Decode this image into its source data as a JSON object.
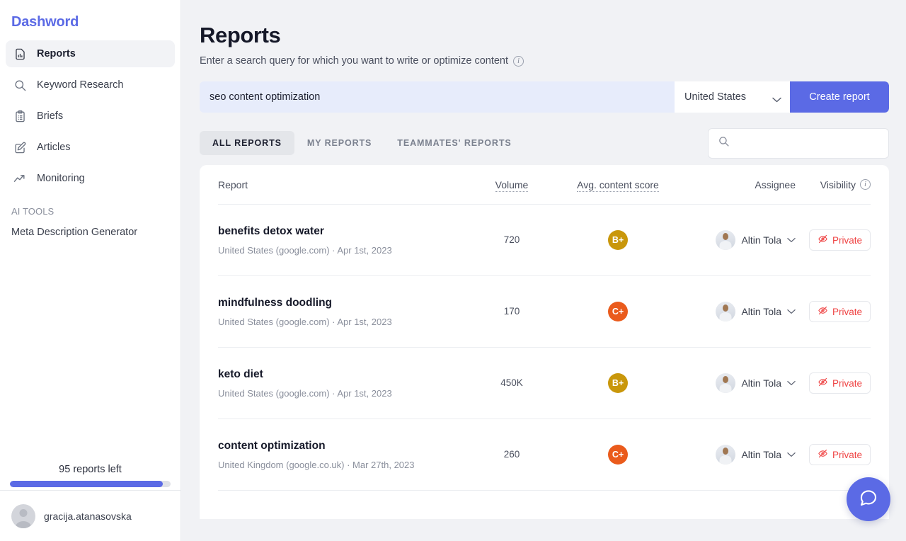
{
  "sidebar": {
    "brand": "Dashword",
    "items": [
      {
        "label": "Reports",
        "icon": "report-doc-icon",
        "active": true
      },
      {
        "label": "Keyword Research",
        "icon": "search-icon",
        "active": false
      },
      {
        "label": "Briefs",
        "icon": "clipboard-icon",
        "active": false
      },
      {
        "label": "Articles",
        "icon": "pencil-square-icon",
        "active": false
      },
      {
        "label": "Monitoring",
        "icon": "trending-up-icon",
        "active": false
      }
    ],
    "section_label": "AI TOOLS",
    "tools": [
      {
        "label": "Meta Description Generator"
      }
    ],
    "quota": {
      "label": "95 reports left",
      "percent": 95
    },
    "user": {
      "name": "gracija.atanasovska",
      "avatar_icon": "user-avatar-icon"
    }
  },
  "header": {
    "title": "Reports",
    "subtitle": "Enter a search query for which you want to write or optimize content",
    "info_icon": "info-icon"
  },
  "query": {
    "value": "seo content optimization",
    "placeholder": "Enter a search query",
    "country": "United States",
    "country_chevron_icon": "chevron-down-icon",
    "create_label": "Create report"
  },
  "tabs": [
    {
      "label": "ALL REPORTS",
      "active": true
    },
    {
      "label": "MY REPORTS",
      "active": false
    },
    {
      "label": "TEAMMATES' REPORTS",
      "active": false
    }
  ],
  "search": {
    "value": "",
    "placeholder": "",
    "icon": "search-icon"
  },
  "table": {
    "columns": {
      "report": "Report",
      "volume": "Volume",
      "score": "Avg. content score",
      "assignee": "Assignee",
      "visibility": "Visibility",
      "visibility_info_icon": "info-icon"
    },
    "rows": [
      {
        "keyword": "benefits detox water",
        "meta": "United States (google.com) · Apr 1st, 2023",
        "volume": "720",
        "score": "B+",
        "score_color": "#c9970b",
        "assignee": "Altin Tola",
        "visibility": "Private",
        "visibility_icon": "eye-off-icon"
      },
      {
        "keyword": "mindfulness doodling",
        "meta": "United States (google.com) · Apr 1st, 2023",
        "volume": "170",
        "score": "C+",
        "score_color": "#ea5b1c",
        "assignee": "Altin Tola",
        "visibility": "Private",
        "visibility_icon": "eye-off-icon"
      },
      {
        "keyword": "keto diet",
        "meta": "United States (google.com) · Apr 1st, 2023",
        "volume": "450K",
        "score": "B+",
        "score_color": "#c9970b",
        "assignee": "Altin Tola",
        "visibility": "Private",
        "visibility_icon": "eye-off-icon"
      },
      {
        "keyword": "content optimization",
        "meta": "United Kingdom (google.co.uk) · Mar 27th, 2023",
        "volume": "260",
        "score": "C+",
        "score_color": "#ea5b1c",
        "assignee": "Altin Tola",
        "visibility": "Private",
        "visibility_icon": "eye-off-icon"
      }
    ]
  },
  "chat": {
    "icon": "chat-bubble-icon"
  },
  "colors": {
    "brand": "#5b6ae5",
    "page_background": "#f1f2f5",
    "query_field": "#e7ecfb",
    "danger": "#ef4444"
  }
}
